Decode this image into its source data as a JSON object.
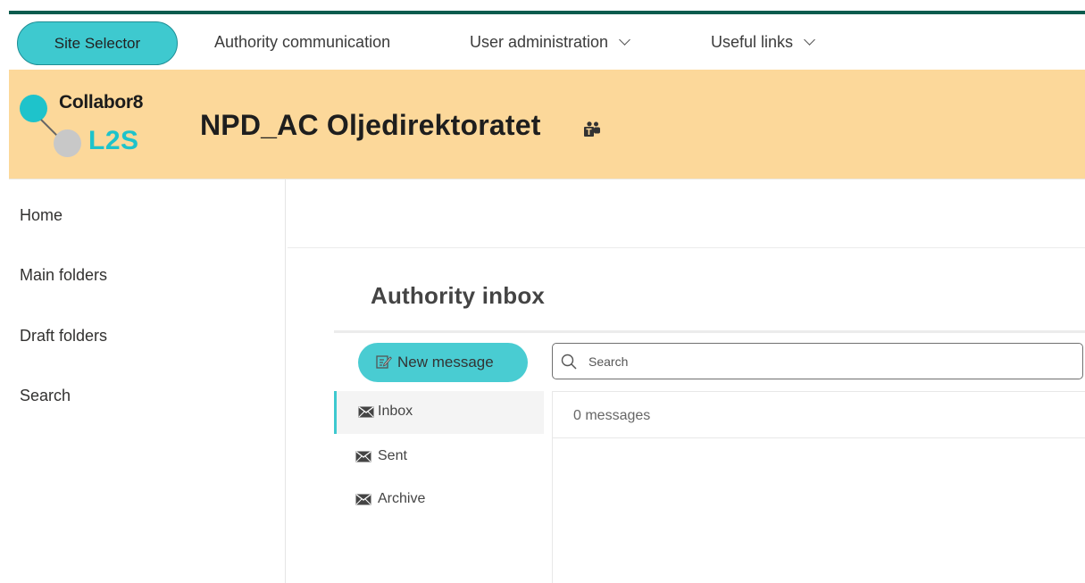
{
  "topnav": {
    "site_selector": "Site Selector",
    "links": [
      {
        "label": "Authority communication",
        "has_dropdown": false
      },
      {
        "label": "User administration",
        "has_dropdown": true
      },
      {
        "label": "Useful links",
        "has_dropdown": true
      }
    ]
  },
  "banner": {
    "logo_line1": "Collabor8",
    "logo_line2": "L2S",
    "site_title": "NPD_AC Oljedirektoratet",
    "site_icon": "teams-icon"
  },
  "leftnav": {
    "items": [
      "Home",
      "Main folders",
      "Draft folders",
      "Search"
    ]
  },
  "inbox": {
    "title": "Authority inbox",
    "new_message_label": "New message",
    "search_placeholder": "Search",
    "folders": [
      {
        "label": "Inbox",
        "icon": "envelope-icon",
        "active": true
      },
      {
        "label": "Sent",
        "icon": "envelope-icon",
        "active": false
      },
      {
        "label": "Archive",
        "icon": "envelope-icon",
        "active": false
      }
    ],
    "message_count": "0 messages"
  },
  "colors": {
    "accent": "#3ec9cf",
    "banner": "#fcd89a",
    "top_bar": "#0b5c4e"
  }
}
